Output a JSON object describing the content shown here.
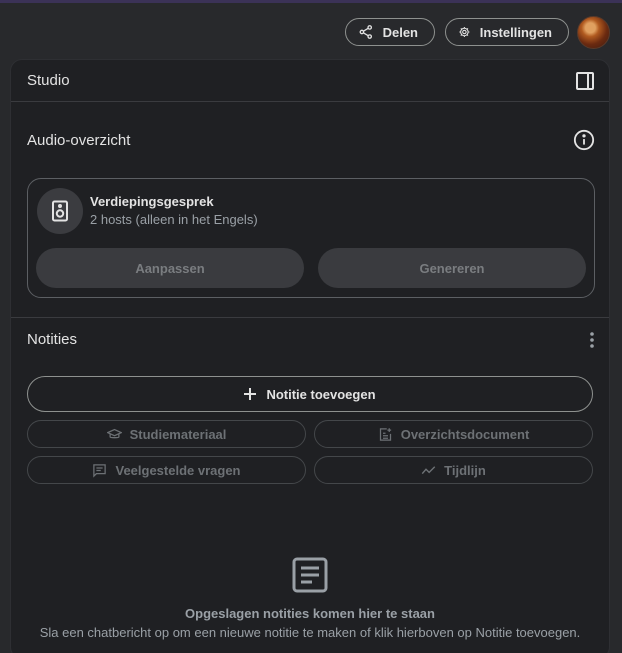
{
  "topbar": {
    "share_label": "Delen",
    "settings_label": "Instellingen"
  },
  "panel": {
    "title": "Studio"
  },
  "audio": {
    "title": "Audio-overzicht",
    "card": {
      "name": "Verdiepingsgesprek",
      "subtitle": "2 hosts (alleen in het Engels)",
      "customize_label": "Aanpassen",
      "generate_label": "Genereren"
    }
  },
  "notes": {
    "title": "Notities",
    "add_label": "Notitie toevoegen",
    "chips": [
      {
        "label": "Studiemateriaal",
        "icon": "graduation-cap-icon"
      },
      {
        "label": "Overzichtsdocument",
        "icon": "document-add-icon"
      },
      {
        "label": "Veelgestelde vragen",
        "icon": "faq-icon"
      },
      {
        "label": "Tijdlijn",
        "icon": "timeline-icon"
      }
    ],
    "empty_title": "Opgeslagen notities komen hier te staan",
    "empty_subtitle": "Sla een chatbericht op om een nieuwe notitie te maken of klik hierboven op Notitie toevoegen."
  },
  "colors": {
    "background": "#28292c",
    "panel": "#1f2023",
    "accent_line": "#3b3257"
  }
}
